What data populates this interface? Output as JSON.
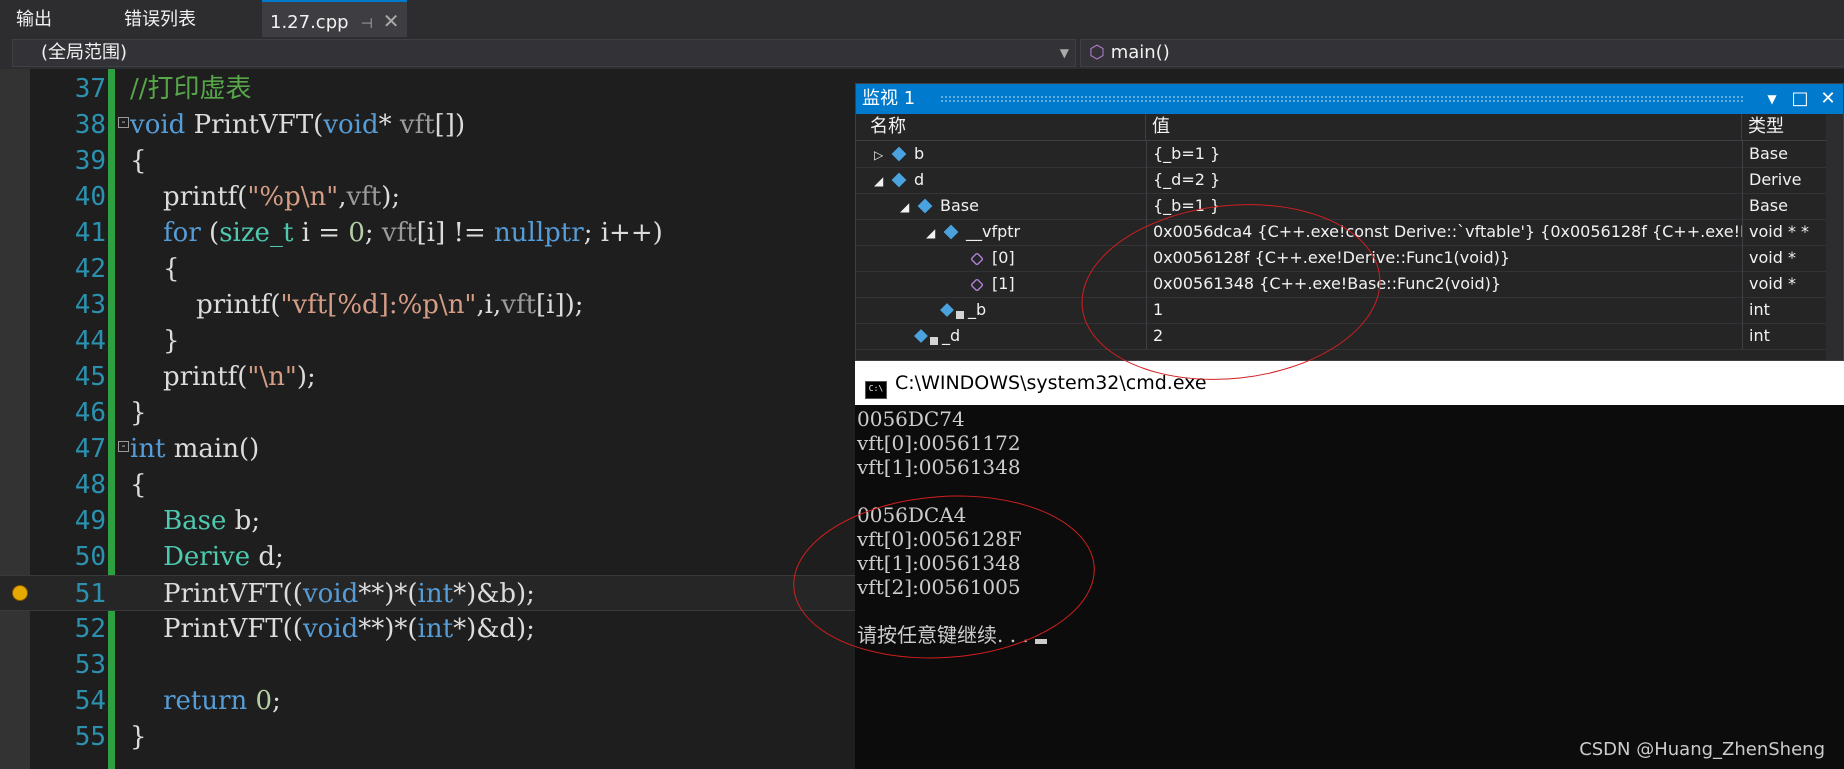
{
  "tabs": [
    {
      "label": "输出"
    },
    {
      "label": "错误列表"
    },
    {
      "label": "1.27.cpp",
      "pin": "⊣",
      "close": "✕"
    }
  ],
  "nav": {
    "scope": "(全局范围)",
    "function": "main()"
  },
  "editor": {
    "line_numbers": [
      "37",
      "38",
      "39",
      "40",
      "41",
      "42",
      "43",
      "44",
      "45",
      "46",
      "47",
      "48",
      "49",
      "50",
      "51",
      "52",
      "53",
      "54",
      "55"
    ],
    "current_line": "51"
  },
  "watch": {
    "title": "监视 1",
    "headers": {
      "name": "名称",
      "value": "值",
      "type": "类型"
    },
    "rows": [
      {
        "name": "b",
        "value": "{_b=1 }",
        "type": "Base"
      },
      {
        "name": "d",
        "value": "{_d=2 }",
        "type": "Derive"
      },
      {
        "name": "Base",
        "value": "{_b=1 }",
        "type": "Base"
      },
      {
        "name": "__vfptr",
        "value": "0x0056dca4 {C++.exe!const Derive::`vftable'} {0x0056128f {C++.exe!Derive::",
        "type": "void * *"
      },
      {
        "name": "[0]",
        "value": "0x0056128f {C++.exe!Derive::Func1(void)}",
        "type": "void *"
      },
      {
        "name": "[1]",
        "value": "0x00561348 {C++.exe!Base::Func2(void)}",
        "type": "void *"
      },
      {
        "name": "_b",
        "value": "1",
        "type": "int"
      },
      {
        "name": "_d",
        "value": "2",
        "type": "int"
      }
    ]
  },
  "console": {
    "title": "C:\\WINDOWS\\system32\\cmd.exe",
    "icon_text": "C:\\",
    "lines": [
      "0056DC74",
      "vft[0]:00561172",
      "vft[1]:00561348",
      "",
      "0056DCA4",
      "vft[0]:0056128F",
      "vft[1]:00561348",
      "vft[2]:00561005",
      "",
      "请按任意键继续. . . "
    ]
  },
  "watermark": "CSDN @Huang_ZhenSheng",
  "colors": {
    "accent": "#007acc",
    "annotation": "#d21f1f",
    "change_bar": "#2ea043"
  }
}
